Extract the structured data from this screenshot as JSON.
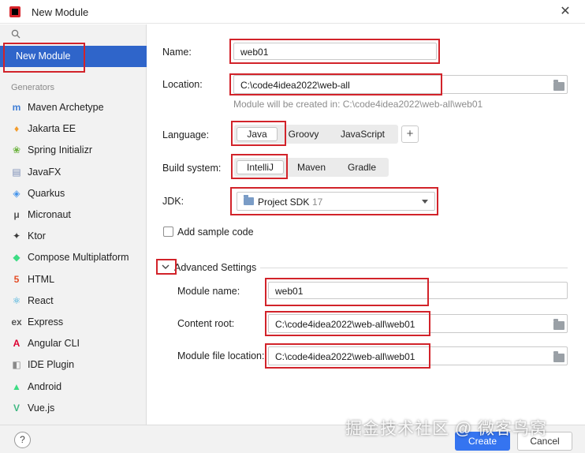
{
  "window": {
    "title": "New Module",
    "close_glyph": "✕"
  },
  "sidebar": {
    "selected_label": "New Module",
    "generators_header": "Generators",
    "items": [
      {
        "label": "Maven Archetype",
        "icon": "maven-icon",
        "glyph": "m",
        "color": "#3f7ed6"
      },
      {
        "label": "Jakarta EE",
        "icon": "jakarta-icon",
        "glyph": "♦",
        "color": "#f39c2c"
      },
      {
        "label": "Spring Initializr",
        "icon": "spring-icon",
        "glyph": "❀",
        "color": "#6db33f"
      },
      {
        "label": "JavaFX",
        "icon": "javafx-icon",
        "glyph": "▤",
        "color": "#7b8db5"
      },
      {
        "label": "Quarkus",
        "icon": "quarkus-icon",
        "glyph": "◈",
        "color": "#4695eb"
      },
      {
        "label": "Micronaut",
        "icon": "micronaut-icon",
        "glyph": "μ",
        "color": "#555555"
      },
      {
        "label": "Ktor",
        "icon": "ktor-icon",
        "glyph": "✦",
        "color": "#3a3a3a"
      },
      {
        "label": "Compose Multiplatform",
        "icon": "compose-icon",
        "glyph": "◆",
        "color": "#3ddc84"
      },
      {
        "label": "HTML",
        "icon": "html-icon",
        "glyph": "5",
        "color": "#e44d26"
      },
      {
        "label": "React",
        "icon": "react-icon",
        "glyph": "⚛",
        "color": "#2fa8d8"
      },
      {
        "label": "Express",
        "icon": "express-icon",
        "glyph": "ex",
        "color": "#555555"
      },
      {
        "label": "Angular CLI",
        "icon": "angular-icon",
        "glyph": "A",
        "color": "#dd0031"
      },
      {
        "label": "IDE Plugin",
        "icon": "plugin-icon",
        "glyph": "◧",
        "color": "#8a8a8a"
      },
      {
        "label": "Android",
        "icon": "android-icon",
        "glyph": "▲",
        "color": "#3ddc84"
      },
      {
        "label": "Vue.js",
        "icon": "vue-icon",
        "glyph": "V",
        "color": "#41b883"
      }
    ]
  },
  "form": {
    "name_label": "Name:",
    "name_value": "web01",
    "location_label": "Location:",
    "location_value": "C:\\code4idea2022\\web-all",
    "location_hint": "Module will be created in: C:\\code4idea2022\\web-all\\web01",
    "language_label": "Language:",
    "language_options": [
      "Java",
      "Groovy",
      "JavaScript"
    ],
    "language_selected": "Java",
    "build_label": "Build system:",
    "build_options": [
      "IntelliJ",
      "Maven",
      "Gradle"
    ],
    "build_selected": "IntelliJ",
    "jdk_label": "JDK:",
    "jdk_name": "Project SDK",
    "jdk_version": "17",
    "sample_code_label": "Add sample code",
    "sample_code_checked": false,
    "advanced_label": "Advanced Settings",
    "module_name_label": "Module name:",
    "module_name_value": "web01",
    "content_root_label": "Content root:",
    "content_root_value": "C:\\code4idea2022\\web-all\\web01",
    "module_file_label": "Module file location:",
    "module_file_value": "C:\\code4idea2022\\web-all\\web01"
  },
  "footer": {
    "help_label": "?",
    "create_label": "Create",
    "cancel_label": "Cancel",
    "watermark": "掘金技术社区 @ 微客鸟窝"
  },
  "colors": {
    "accent": "#3574f0",
    "selection": "#2f65ca",
    "highlight_box": "#d2232a"
  }
}
